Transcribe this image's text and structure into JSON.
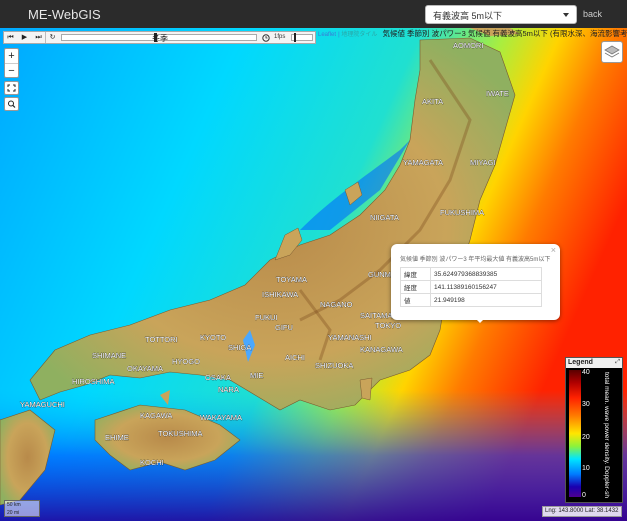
{
  "app": {
    "title": "ME-WebGIS"
  },
  "layer_selector": {
    "selected": "有義波高 5m以下"
  },
  "nav": {
    "back_label": "back"
  },
  "attribution": {
    "leaflet": "Leaflet",
    "tiles": "地理院タイル",
    "text": "気候値 季節別 波パワー3 気候値 有義波高5m以下 (有限水深、海流影響考慮)"
  },
  "timeline": {
    "buttons": [
      "⏮",
      "▶",
      "⏭",
      "↻"
    ],
    "season": "冬季",
    "fps_label": "1fps"
  },
  "zoom": {
    "in": "+",
    "out": "−"
  },
  "popup": {
    "title": "気候値 季節別 波パワー3 年平均最大値 有義波高5m以下",
    "rows": [
      {
        "key": "緯度",
        "value": "35.624979368839385"
      },
      {
        "key": "経度",
        "value": "141.11389160156247"
      },
      {
        "key": "値",
        "value": "21.949198"
      }
    ],
    "close": "×"
  },
  "legend": {
    "title": "Legend",
    "max": "40",
    "ticks": [
      "30",
      "20",
      "10",
      "0"
    ],
    "caption": "total mean. wave power density. Doppler-sh"
  },
  "coordinate_readout": {
    "text": "Lng: 143.8000 Lat: 38.1432"
  },
  "scale": {
    "top": "50 km",
    "bottom": "20 mi"
  },
  "map_labels": {
    "aomori": "AOMORI",
    "iwate": "IWATE",
    "akita": "AKITA",
    "miyagi": "MIYAGI",
    "yamagata": "YAMAGATA",
    "niigata": "NIIGATA",
    "fukushima": "FUKUSHIMA",
    "toyama": "TOYAMA",
    "ishikawa": "ISHIKAWA",
    "gunma": "GUNMA",
    "tochigi": "TOCHIGI",
    "nagano": "NAGANO",
    "fukui": "FUKUI",
    "gifu": "GIFU",
    "saitama": "SAITAMA",
    "tokyo": "TOKYO",
    "yamanashi": "YAMANASHI",
    "shizuoka": "SHIZUOKA",
    "aichi": "AICHI",
    "mie": "MIE",
    "shiga": "SHIGA",
    "kyoto": "KYOTO",
    "nara": "NARA",
    "hyogo": "HYOGO",
    "osaka": "OSAKA",
    "wakayama": "WAKAYAMA",
    "tottori": "TOTTORI",
    "shimane": "SHIMANE",
    "okayama": "OKAYAMA",
    "hiroshima": "HIROSHIMA",
    "yamaguchi": "YAMAGUCHI",
    "tokushima": "TOKUSHIMA",
    "kagawa": "KAGAWA",
    "ehime": "EHIME",
    "kochi": "KOCHI",
    "tochigi2": "TOCHIGI",
    "kanagawa": "KANAGAWA"
  },
  "colors": {
    "navbar": "#2b2b2b",
    "sea_warm": "#ff2a00",
    "sea_cool": "#00c8ff",
    "land": "#c9a45a"
  }
}
